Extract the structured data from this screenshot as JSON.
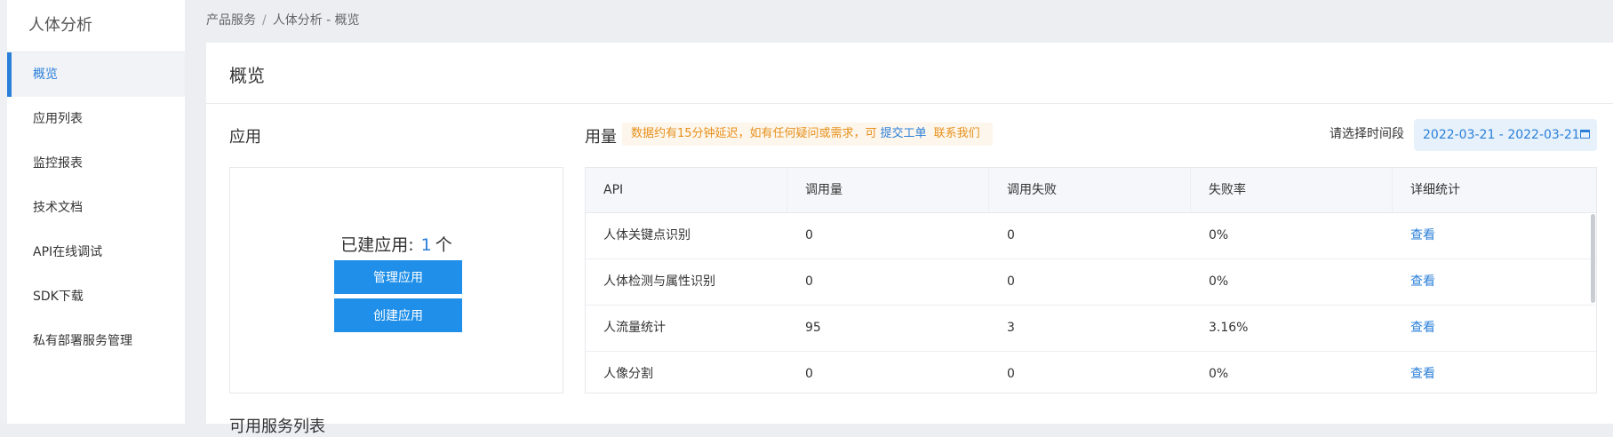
{
  "sidebar": {
    "title": "人体分析",
    "items": [
      {
        "label": "概览"
      },
      {
        "label": "应用列表"
      },
      {
        "label": "监控报表"
      },
      {
        "label": "技术文档"
      },
      {
        "label": "API在线调试"
      },
      {
        "label": "SDK下载"
      },
      {
        "label": "私有部署服务管理"
      }
    ]
  },
  "breadcrumb": {
    "root": "产品服务",
    "separator": "/",
    "current": "人体分析 - 概览"
  },
  "panel": {
    "title": "概览"
  },
  "apps": {
    "title": "应用",
    "count_prefix": "已建应用:",
    "count": "1",
    "count_unit": "个",
    "manage_label": "管理应用",
    "create_label": "创建应用"
  },
  "usage": {
    "title": "用量",
    "notice_text": "数据约有15分钟延迟，如有任何疑问或需求，可",
    "ticket_link": "提交工单",
    "contact_link": "联系我们",
    "date_label": "请选择时间段",
    "date_range": "2022-03-21 - 2022-03-21",
    "columns": [
      "API",
      "调用量",
      "调用失败",
      "失败率",
      "详细统计"
    ],
    "rows": [
      {
        "api": "人体关键点识别",
        "calls": "0",
        "fails": "0",
        "rate": "0%",
        "detail": "查看"
      },
      {
        "api": "人体检测与属性识别",
        "calls": "0",
        "fails": "0",
        "rate": "0%",
        "detail": "查看"
      },
      {
        "api": "人流量统计",
        "calls": "95",
        "fails": "3",
        "rate": "3.16%",
        "detail": "查看"
      },
      {
        "api": "人像分割",
        "calls": "0",
        "fails": "0",
        "rate": "0%",
        "detail": "查看"
      }
    ]
  },
  "next_section": {
    "title": "可用服务列表"
  },
  "colors": {
    "accent": "#2a7fd9",
    "button": "#1f8fe9",
    "notice": "#e6901b"
  }
}
